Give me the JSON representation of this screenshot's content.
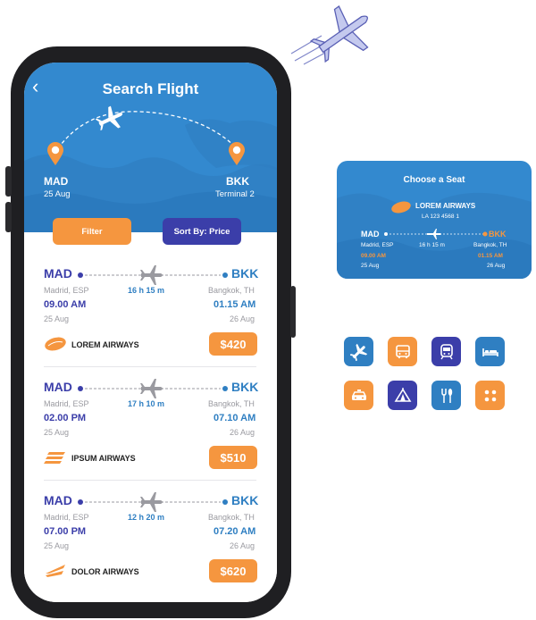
{
  "screen": {
    "title": "Search Flight",
    "origin": {
      "code": "MAD",
      "date": "25 Aug"
    },
    "destination": {
      "code": "BKK",
      "terminal": "Terminal 2"
    },
    "filter_label": "Filter",
    "sort_label": "Sort By: Price"
  },
  "flights": [
    {
      "from": "MAD",
      "to": "BKK",
      "from_city": "Madrid, ESP",
      "to_city": "Bangkok, TH",
      "duration": "16 h 15 m",
      "dep_time": "09.00 AM",
      "arr_time": "01.15 AM",
      "dep_date": "25 Aug",
      "arr_date": "26 Aug",
      "airline": "LOREM AIRWAYS",
      "price": "$420"
    },
    {
      "from": "MAD",
      "to": "BKK",
      "from_city": "Madrid, ESP",
      "to_city": "Bangkok, TH",
      "duration": "17 h 10 m",
      "dep_time": "02.00 PM",
      "arr_time": "07.10 AM",
      "dep_date": "25 Aug",
      "arr_date": "26 Aug",
      "airline": "IPSUM AIRWAYS",
      "price": "$510"
    },
    {
      "from": "MAD",
      "to": "BKK",
      "from_city": "Madrid, ESP",
      "to_city": "Bangkok, TH",
      "duration": "12 h 20 m",
      "dep_time": "07.00 PM",
      "arr_time": "07.20 AM",
      "dep_date": "25 Aug",
      "arr_date": "26 Aug",
      "airline": "DOLOR AIRWAYS",
      "price": "$620"
    }
  ],
  "seat_card": {
    "title": "Choose a Seat",
    "airline": "LOREM AIRWAYS",
    "flight_no": "LA 123 4568 1",
    "from": "MAD",
    "to": "BKK",
    "from_city": "Madrid, ESP",
    "to_city": "Bangkok, TH",
    "duration": "16 h 15 m",
    "dep_time": "09.00 AM",
    "arr_time": "01.15 AM",
    "dep_date": "25 Aug",
    "arr_date": "26 Aug"
  },
  "icons": [
    {
      "name": "plane-icon",
      "color": "#2f7fc2"
    },
    {
      "name": "bus-icon",
      "color": "#f5963f"
    },
    {
      "name": "train-icon",
      "color": "#3b3ea9"
    },
    {
      "name": "bed-icon",
      "color": "#2f7fc2"
    },
    {
      "name": "taxi-icon",
      "color": "#f5963f"
    },
    {
      "name": "tent-icon",
      "color": "#3b3ea9"
    },
    {
      "name": "restaurant-icon",
      "color": "#2f7fc2"
    },
    {
      "name": "grid-icon",
      "color": "#f5963f"
    }
  ],
  "colors": {
    "primary_blue": "#3389cf",
    "accent_orange": "#f5963f",
    "deep_purple": "#3b3ea9"
  }
}
